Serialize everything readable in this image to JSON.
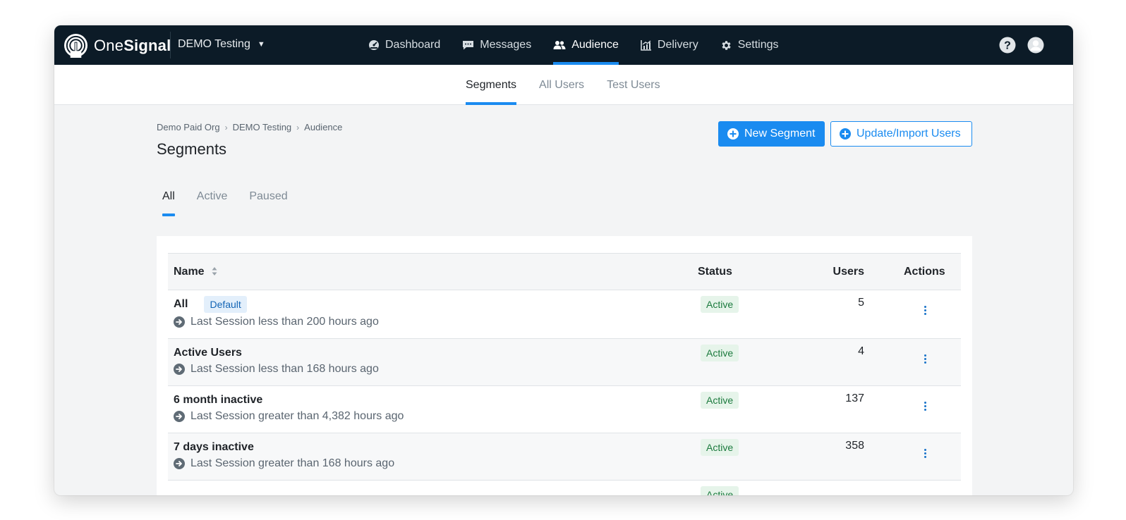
{
  "app": {
    "logo_one": "One",
    "logo_signal": "Signal",
    "current_app": "DEMO Testing"
  },
  "nav": [
    {
      "label": "Dashboard",
      "icon": "dashboard-icon"
    },
    {
      "label": "Messages",
      "icon": "messages-icon"
    },
    {
      "label": "Audience",
      "icon": "audience-icon",
      "active": true
    },
    {
      "label": "Delivery",
      "icon": "delivery-icon"
    },
    {
      "label": "Settings",
      "icon": "settings-icon"
    }
  ],
  "subnav": [
    {
      "label": "Segments",
      "active": true
    },
    {
      "label": "All Users"
    },
    {
      "label": "Test Users"
    }
  ],
  "breadcrumb": [
    "Demo Paid Org",
    "DEMO Testing",
    "Audience"
  ],
  "page_title": "Segments",
  "buttons": {
    "new_segment": "New Segment",
    "update_import": "Update/Import Users"
  },
  "filters": [
    {
      "label": "All",
      "active": true
    },
    {
      "label": "Active"
    },
    {
      "label": "Paused"
    }
  ],
  "table": {
    "headers": {
      "name": "Name",
      "status": "Status",
      "users": "Users",
      "actions": "Actions"
    },
    "rows": [
      {
        "name": "All",
        "badge": "Default",
        "rule": "Last Session less than 200 hours ago",
        "status": "Active",
        "users": "5"
      },
      {
        "name": "Active Users",
        "badge": "",
        "rule": "Last Session less than 168 hours ago",
        "status": "Active",
        "users": "4"
      },
      {
        "name": "6 month inactive",
        "badge": "",
        "rule": "Last Session greater than 4,382 hours ago",
        "status": "Active",
        "users": "137"
      },
      {
        "name": "7 days inactive",
        "badge": "",
        "rule": "Last Session greater than 168 hours ago",
        "status": "Active",
        "users": "358"
      },
      {
        "name": "",
        "badge": "",
        "rule": "",
        "status": "Active",
        "users": ""
      }
    ]
  },
  "colors": {
    "nav_bg": "#0c1b27",
    "accent": "#1a8bf0",
    "status_active_bg": "#e6f4ea",
    "status_active_text": "#1b7a3d"
  }
}
